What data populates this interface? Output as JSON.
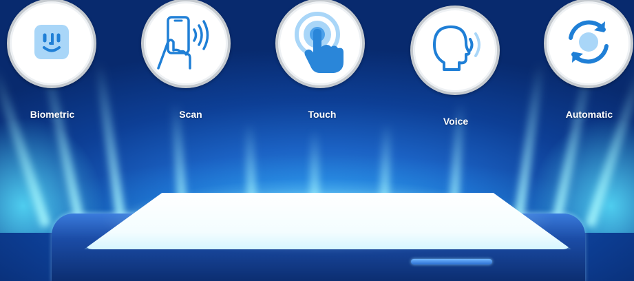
{
  "features": [
    {
      "label": "Biometric",
      "icon": "face-id-icon"
    },
    {
      "label": "Scan",
      "icon": "phone-scan-icon"
    },
    {
      "label": "Touch",
      "icon": "touch-icon"
    },
    {
      "label": "Voice",
      "icon": "voice-icon"
    },
    {
      "label": "Automatic",
      "icon": "sync-icon"
    }
  ],
  "colors": {
    "background": "#0d3f96",
    "icon_blue": "#1f7fd6",
    "icon_light": "#a9d6f8",
    "glow": "#8ff0ff"
  }
}
